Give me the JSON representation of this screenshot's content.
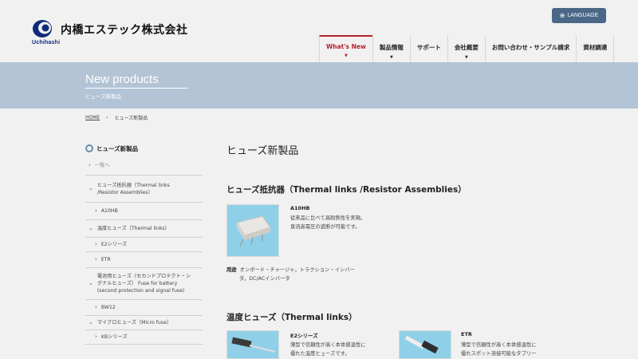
{
  "header": {
    "logo_text": "内橋エステック株式会社",
    "logo_sub": "Uchihashi",
    "language_label": "LANGUAGE",
    "nav": [
      {
        "label": "What's New",
        "active": true
      },
      {
        "label": "製品情報",
        "active": false
      },
      {
        "label": "サポート",
        "active": false
      },
      {
        "label": "会社概要",
        "active": false
      },
      {
        "label": "お問い合わせ・サンプル請求",
        "active": false
      },
      {
        "label": "資材調達",
        "active": false
      }
    ]
  },
  "banner": {
    "title": "New products",
    "subtitle": "ヒューズ新製品"
  },
  "breadcrumb": {
    "home": "HOME",
    "separator": "›",
    "current": "ヒューズ新製品"
  },
  "sidebar": {
    "heading": "ヒューズ新製品",
    "items": [
      {
        "label": "一覧へ"
      },
      {
        "label": "ヒューズ抵抗器（Thermal links /Resistor Assemblies）"
      },
      {
        "label": "A10HB"
      },
      {
        "label": "温度ヒューズ（Thermal links）"
      },
      {
        "label": "E2シリーズ"
      },
      {
        "label": "ETR"
      },
      {
        "label": "電池用ヒューズ（セカンドプロテクト・シグナルヒューズ） Fuse for battery (second protection and signal fuse)"
      },
      {
        "label": "BW12"
      },
      {
        "label": "マイクロヒューズ（Micro fuse）"
      },
      {
        "label": "KBシリーズ"
      }
    ]
  },
  "main": {
    "page_title": "ヒューズ新製品",
    "section1": {
      "title": "ヒューズ抵抗器（Thermal links /Resistor Assemblies）",
      "product": {
        "name": "A10HB",
        "desc1": "従来品に比べて高耐熱性を実現。",
        "desc2": "直流高電圧の遮断が可能です。",
        "usage_label": "用途",
        "usage1": "オンボード・チャージャ，トラクション・インバー",
        "usage2": "タ，DC/ACインバータ"
      }
    },
    "section2": {
      "title": "温度ヒューズ（Thermal links）",
      "products": [
        {
          "name": "E2シリーズ",
          "desc1": "薄型で信頼性が高く本体感温性に",
          "desc2": "優れた温度ヒューズです。"
        },
        {
          "name": "ETR",
          "desc1": "薄型で信頼性が高く本体感温性に",
          "desc2": "優れスポット溶接可能なタブリー"
        }
      ]
    }
  },
  "colors": {
    "accent_red": "#b4232e",
    "banner_blue": "#b3c4d6",
    "language_button": "#4b6787",
    "logo_blue": "#0e2a7a"
  }
}
